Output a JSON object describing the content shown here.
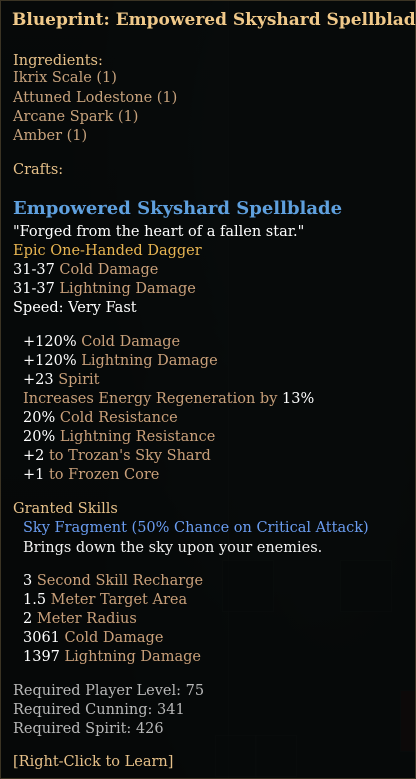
{
  "colors": {
    "title": "#f0c98a",
    "header": "#e6c089",
    "ingredient": "#c7a27c",
    "item_name": "#5fa0de",
    "flavor": "#ffffff",
    "rarity": "#e8b552",
    "stat_value": "#ffffff",
    "stat_label": "#c9a07a",
    "skill_name": "#6a9cf0",
    "skill_desc": "#f0f0f0",
    "requirement": "#b8b8b8",
    "learn": "#e6c089"
  },
  "title": "Blueprint: Empowered Skyshard Spellblade",
  "ingredients": {
    "header": "Ingredients:",
    "items": [
      "Ikrix Scale (1)",
      "Attuned Lodestone (1)",
      "Arcane Spark (1)",
      "Amber (1)"
    ]
  },
  "crafts": {
    "header": "Crafts:",
    "item_name": "Empowered Skyshard Spellblade",
    "flavor": "\"Forged from the heart of a fallen star.\"",
    "rarity": "Epic One-Handed Dagger",
    "base_stats": [
      {
        "value": "31-37",
        "label": " Cold Damage"
      },
      {
        "value": "31-37",
        "label": " Lightning Damage"
      },
      {
        "value": "Speed:",
        "label": "  Very Fast"
      }
    ],
    "bonuses": [
      {
        "value": "+120%",
        "label": " Cold Damage"
      },
      {
        "value": "+120%",
        "label": " Lightning Damage"
      },
      {
        "value": "+23",
        "label": " Spirit"
      },
      {
        "value": "",
        "label": "Increases Energy Regeneration by ",
        "suffix": "13%"
      },
      {
        "value": "20%",
        "label": " Cold Resistance"
      },
      {
        "value": "20%",
        "label": " Lightning Resistance"
      },
      {
        "value": "+2",
        "label": " to Trozan's Sky Shard"
      },
      {
        "value": "+1",
        "label": " to Frozen Core"
      }
    ]
  },
  "granted_skills": {
    "header": "Granted Skills",
    "name": "Sky Fragment (50% Chance on Critical Attack)",
    "description": "Brings down the sky upon your enemies.",
    "stats": [
      {
        "value": "3",
        "label": " Second Skill Recharge"
      },
      {
        "value": "1.5",
        "label": " Meter Target Area"
      },
      {
        "value": "2",
        "label": " Meter Radius"
      },
      {
        "value": "3061",
        "label": " Cold Damage"
      },
      {
        "value": "1397",
        "label": " Lightning Damage"
      }
    ]
  },
  "requirements": [
    {
      "label": "Required Player Level: ",
      "value": "75"
    },
    {
      "label": "Required Cunning: ",
      "value": "341"
    },
    {
      "label": "Required Spirit: ",
      "value": "426"
    }
  ],
  "learn_hint": "[Right-Click to Learn]"
}
